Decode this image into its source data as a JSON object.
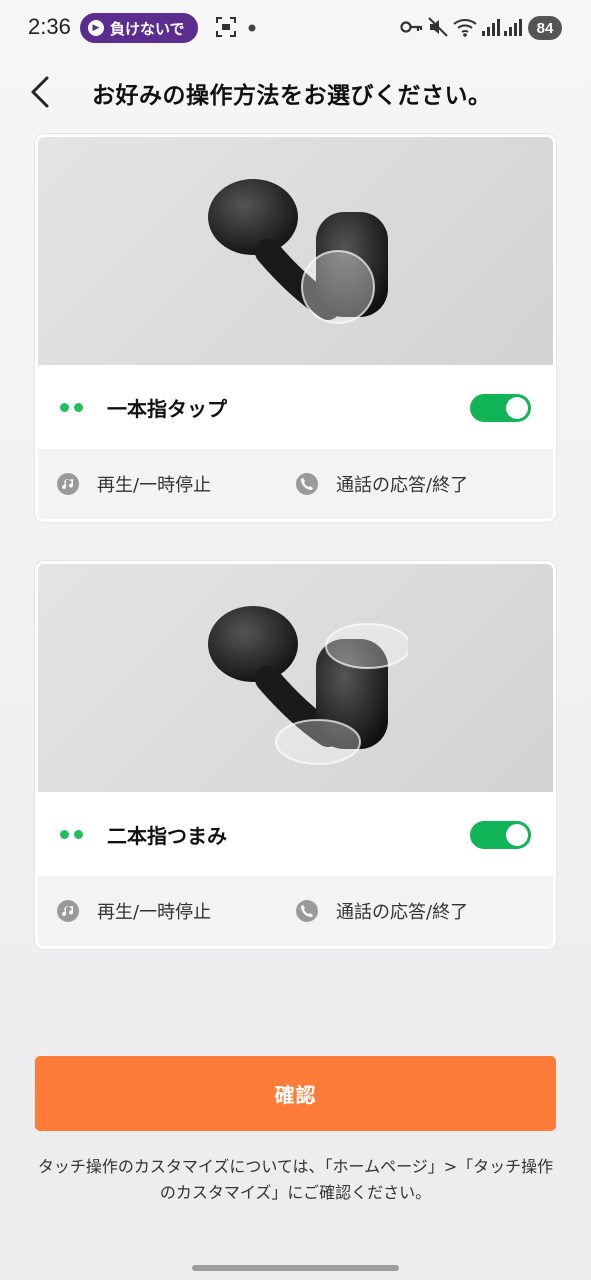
{
  "status_bar": {
    "time": "2:36",
    "media_pill_label": "負けないで",
    "battery": "84"
  },
  "header": {
    "title": "お好みの操作方法をお選びください。"
  },
  "cards": [
    {
      "mode_label": "一本指タップ",
      "toggle_on": true,
      "functions": [
        "再生/一時停止",
        "通話の応答/終了"
      ]
    },
    {
      "mode_label": "二本指つまみ",
      "toggle_on": true,
      "functions": [
        "再生/一時停止",
        "通話の応答/終了"
      ]
    }
  ],
  "confirm_label": "確認",
  "footnote": "タッチ操作のカスタマイズについては、「ホームページ」>「タッチ操作のカスタマイズ」にご確認ください。",
  "colors": {
    "accent_orange": "#ff7b3a",
    "toggle_green": "#11b457",
    "dot_green": "#20c05c",
    "media_pill": "#5b2d8e"
  },
  "icons": {
    "back": "chevron-left-icon",
    "media_pill": "play-circle-icon",
    "screenshot": "screen-capture-icon",
    "key": "key-icon",
    "mute": "mute-icon",
    "wifi": "wifi-icon",
    "signal": "signal-icon",
    "music": "music-note-icon",
    "phone": "phone-icon"
  }
}
